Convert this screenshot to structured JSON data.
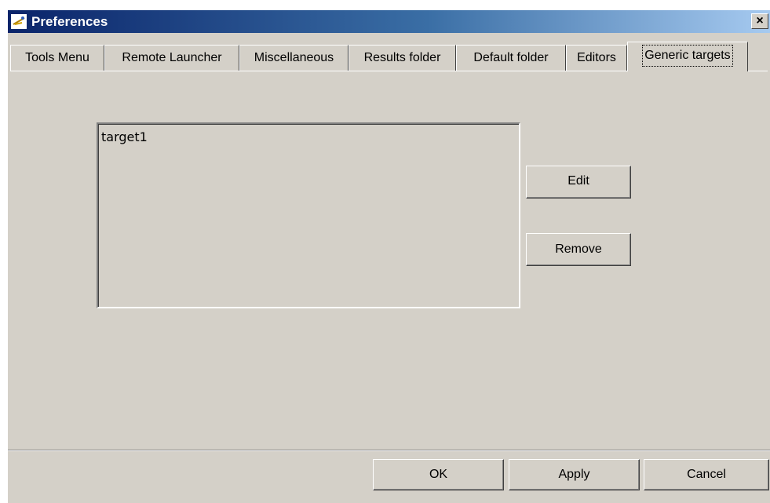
{
  "window": {
    "title": "Preferences",
    "close_label": "×"
  },
  "tabs": [
    {
      "label": "Tools Menu"
    },
    {
      "label": "Remote Launcher"
    },
    {
      "label": "Miscellaneous"
    },
    {
      "label": "Results folder"
    },
    {
      "label": "Default folder"
    },
    {
      "label": "Editors"
    },
    {
      "label": "Generic targets",
      "active": true
    }
  ],
  "targets": {
    "items": [
      "target1"
    ],
    "edit_label": "Edit",
    "remove_label": "Remove"
  },
  "footer": {
    "ok_label": "OK",
    "apply_label": "Apply",
    "cancel_label": "Cancel"
  },
  "colors": {
    "titlebar_start": "#0a246a",
    "titlebar_end": "#a6caf0",
    "face": "#d4d0c8"
  }
}
